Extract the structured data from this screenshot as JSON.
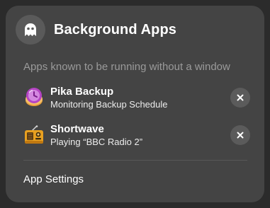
{
  "header": {
    "title": "Background Apps",
    "icon": "ghost-icon"
  },
  "subtitle": "Apps known to be running without a window",
  "apps": [
    {
      "name": "Pika Backup",
      "status": "Monitoring Backup Schedule",
      "icon": "pika-backup-icon",
      "close_icon": "close-icon"
    },
    {
      "name": "Shortwave",
      "status": "Playing “BBC Radio 2”",
      "icon": "radio-icon",
      "close_icon": "close-icon"
    }
  ],
  "footer": {
    "settings_label": "App Settings"
  },
  "colors": {
    "background": "#2b2b2b",
    "popover": "#444444",
    "button": "#5b5b5b",
    "pika_purple": "#c060d0",
    "shortwave_orange": "#e8a020"
  }
}
